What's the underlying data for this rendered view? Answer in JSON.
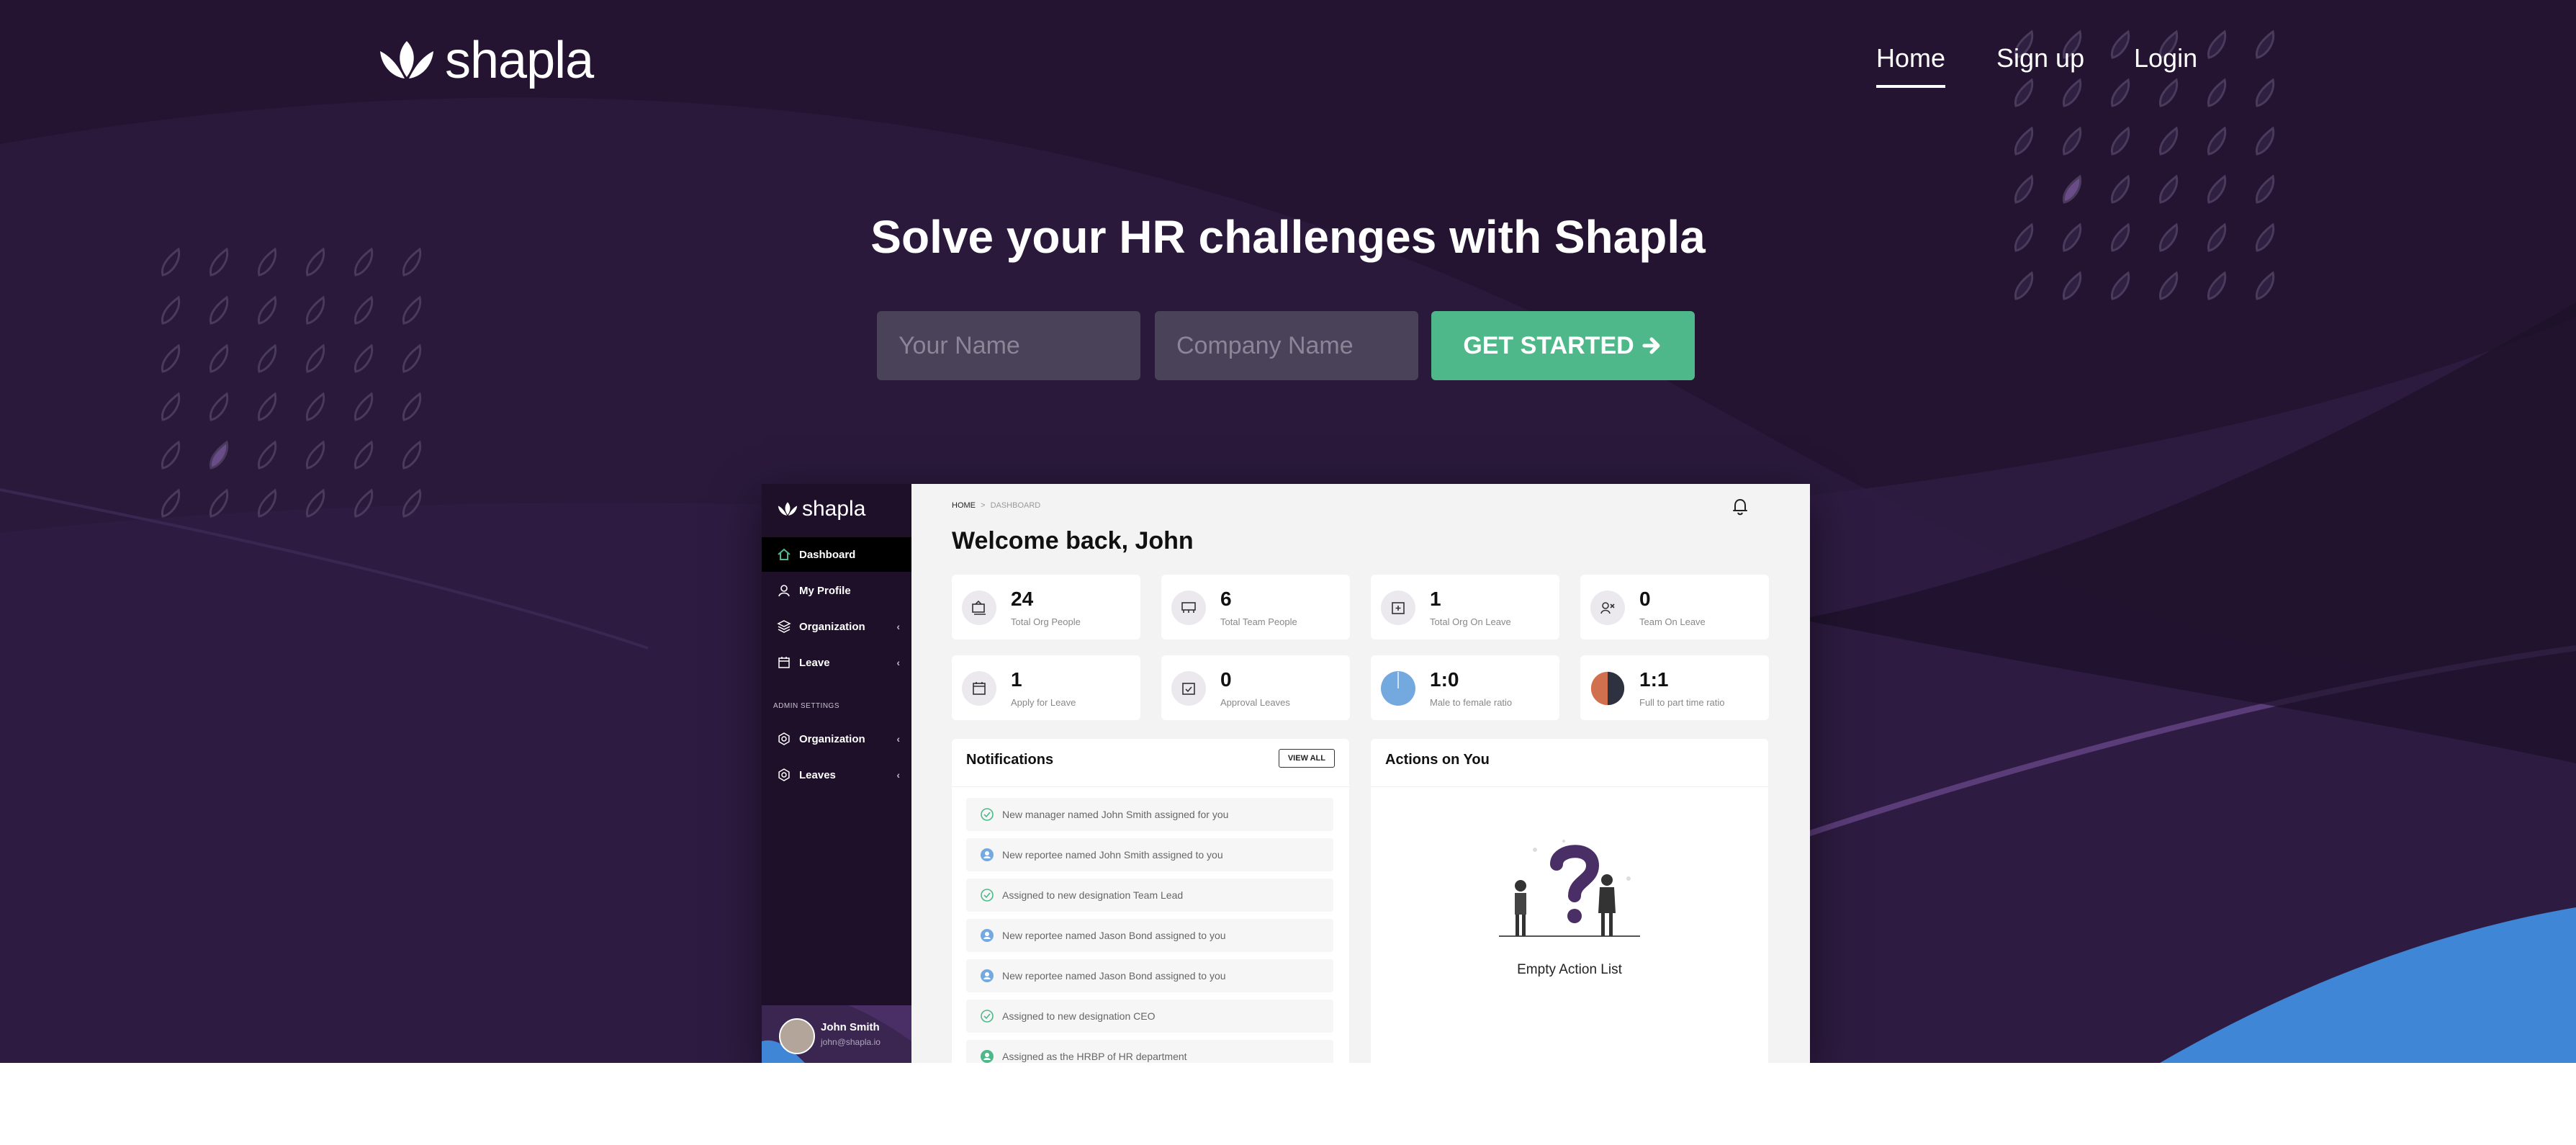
{
  "brand": {
    "name": "shapla"
  },
  "nav": [
    {
      "label": "Home",
      "active": true
    },
    {
      "label": "Sign up",
      "active": false
    },
    {
      "label": "Login",
      "active": false
    }
  ],
  "hero": {
    "headline": "Solve your HR challenges with Shapla",
    "name_placeholder": "Your Name",
    "company_placeholder": "Company Name",
    "cta_label": "GET STARTED"
  },
  "colors": {
    "hero_bg": "#241431",
    "accent_green": "#4fb88a",
    "accent_blue": "#3f86d6",
    "sidebar_bg": "#1f1029"
  },
  "dashboard": {
    "brand": "shapla",
    "sidebar": {
      "items": [
        {
          "label": "Dashboard",
          "icon": "home-icon",
          "active": true
        },
        {
          "label": "My Profile",
          "icon": "user-icon"
        },
        {
          "label": "Organization",
          "icon": "layers-icon",
          "chevron": "‹"
        },
        {
          "label": "Leave",
          "icon": "calendar-icon",
          "chevron": "‹"
        }
      ],
      "admin_section": "ADMIN SETTINGS",
      "admin_items": [
        {
          "label": "Organization",
          "icon": "gear-icon",
          "chevron": "‹"
        },
        {
          "label": "Leaves",
          "icon": "gear-icon",
          "chevron": "‹"
        }
      ],
      "user": {
        "name": "John Smith",
        "email": "john@shapla.io"
      }
    },
    "breadcrumb": {
      "home": "HOME",
      "sep": ">",
      "current": "DASHBOARD"
    },
    "welcome": "Welcome back, John",
    "stats": [
      {
        "value": "24",
        "label": "Total Org People",
        "icon": "people-icon"
      },
      {
        "value": "6",
        "label": "Total Team People",
        "icon": "team-icon"
      },
      {
        "value": "1",
        "label": "Total Org On Leave",
        "icon": "calendar-plus-icon"
      },
      {
        "value": "0",
        "label": "Team On Leave",
        "icon": "group-leave-icon"
      },
      {
        "value": "1",
        "label": "Apply for Leave",
        "icon": "calendar-icon"
      },
      {
        "value": "0",
        "label": "Approval Leaves",
        "icon": "calendar-check-icon"
      },
      {
        "value": "1:0",
        "label": "Male to female ratio",
        "icon": "pie-full-icon"
      },
      {
        "value": "1:1",
        "label": "Full to part time ratio",
        "icon": "pie-half-icon"
      }
    ],
    "notifications": {
      "title": "Notifications",
      "view_all": "VIEW ALL",
      "items": [
        {
          "text": "New manager named John Smith assigned for you",
          "icon": "check-circle-icon"
        },
        {
          "text": "New reportee named John Smith assigned to you",
          "icon": "user-circle-icon"
        },
        {
          "text": "Assigned to new designation Team Lead",
          "icon": "check-circle-icon"
        },
        {
          "text": "New reportee named Jason Bond assigned to you",
          "icon": "user-circle-icon"
        },
        {
          "text": "New reportee named Jason Bond assigned to you",
          "icon": "user-circle-icon"
        },
        {
          "text": "Assigned to new designation CEO",
          "icon": "check-circle-icon"
        },
        {
          "text": "Assigned as the HRBP of HR department",
          "icon": "user-circle-icon"
        }
      ]
    },
    "actions": {
      "title": "Actions on You",
      "empty": "Empty Action List"
    }
  }
}
